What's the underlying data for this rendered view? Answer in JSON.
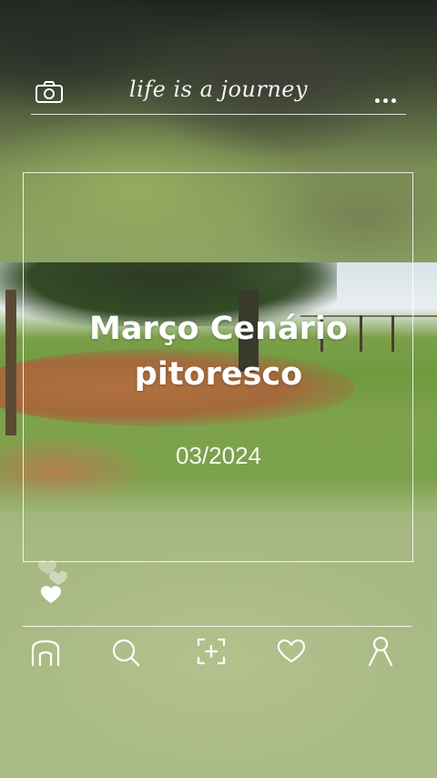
{
  "header": {
    "title": "life is a journey",
    "camera_icon": "camera-icon",
    "more_icon": "more-icon"
  },
  "card": {
    "headline": "Março Cenário pitoresco",
    "date": "03/2024"
  },
  "hearts_icon": "hearts-icon",
  "nav": {
    "items": [
      {
        "icon": "home-icon"
      },
      {
        "icon": "search-icon"
      },
      {
        "icon": "add-icon"
      },
      {
        "icon": "heart-icon"
      },
      {
        "icon": "profile-icon"
      }
    ]
  }
}
